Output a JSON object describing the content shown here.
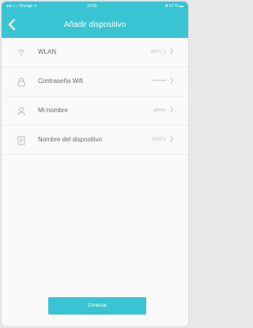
{
  "status_bar": {
    "carrier": "●●○○○ Orange ᯤ",
    "time": "15:55",
    "battery": "✱ 57 % ▬"
  },
  "header": {
    "title": "Añadir dispositivo"
  },
  "colors": {
    "accent": "#38c4d3"
  },
  "rows": [
    {
      "icon": "wifi-icon",
      "label": "WLAN",
      "value": "WIFI_1"
    },
    {
      "icon": "lock-icon",
      "label": "Contraseña Wifi",
      "value": "••••••••"
    },
    {
      "icon": "user-icon",
      "label": "Mi nombre",
      "value": "admin"
    },
    {
      "icon": "device-icon",
      "label": "Nombre del dispositivo",
      "value": "IXDEV"
    }
  ],
  "footer": {
    "button_label": "Conectar"
  }
}
